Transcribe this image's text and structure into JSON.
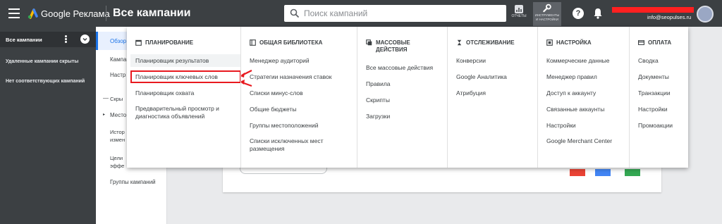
{
  "header": {
    "brand": "Google Реклама",
    "title": "Все кампании",
    "search_placeholder": "Поиск кампаний",
    "reports_label": "ОТЧЕТЫ",
    "tools_label_1": "ИНСТРУМЕНТЫ",
    "tools_label_2": "И НАСТРОЙКИ",
    "help_glyph": "?",
    "email": "info@seopulses.ru"
  },
  "left_panel": {
    "campaigns": "Все кампании",
    "removed_hidden": "Удаленные кампании скрыты",
    "no_matching": "Нет соответствующих кампаний"
  },
  "secondary_nav": {
    "overview": "Обзор",
    "campaigns": "Кампа",
    "settings": "Настр",
    "hide_prefix": "—",
    "hide": "Скры",
    "location": "Место",
    "history_1": "Истор",
    "history_2": "измен",
    "goals_1": "Цели",
    "goals_2": "эффе",
    "campaign_groups": "Группы кампаний"
  },
  "menu": {
    "columns": [
      {
        "header": "ПЛАНИРОВАНИЕ",
        "icon": "calendar-icon",
        "items": [
          "Планировщик результатов",
          "Планировщик ключевых слов",
          "Планировщик охвата",
          "Предварительный просмотр и диагностика объявлений"
        ]
      },
      {
        "header": "ОБЩАЯ БИБЛИОТЕКА",
        "icon": "library-icon",
        "items": [
          "Менеджер аудиторий",
          "Стратегии назначения ставок",
          "Списки минус-слов",
          "Общие бюджеты",
          "Группы местоположений",
          "Списки исключенных мест размещения"
        ]
      },
      {
        "header": "МАССОВЫЕ ДЕЙСТВИЯ",
        "icon": "copy-icon",
        "items": [
          "Все массовые действия",
          "Правила",
          "Скрипты",
          "Загрузки"
        ]
      },
      {
        "header": "ОТСЛЕЖИВАНИЕ",
        "icon": "hourglass-icon",
        "items": [
          "Конверсии",
          "Google Аналитика",
          "Атрибуция"
        ]
      },
      {
        "header": "НАСТРОЙКА",
        "icon": "setup-icon",
        "items": [
          "Коммерческие данные",
          "Менеджер правил",
          "Доступ к аккаунту",
          "Связанные аккаунты",
          "Настройки",
          "Google Merchant Center"
        ]
      },
      {
        "header": "ОПЛАТА",
        "icon": "card-icon",
        "items": [
          "Сводка",
          "Документы",
          "Транзакции",
          "Настройки",
          "Промоакции"
        ]
      }
    ]
  },
  "colors": {
    "header_bg": "#3c4043",
    "highlight_box": "#e8191f",
    "accent": "#1a73e8"
  }
}
